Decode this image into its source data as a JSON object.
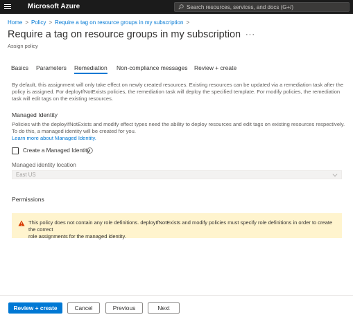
{
  "topbar": {
    "brand": "Microsoft Azure",
    "search_placeholder": "Search resources, services, and docs (G+/)"
  },
  "breadcrumb": {
    "items": [
      "Home",
      "Policy",
      "Require a tag on resource groups in my subscription"
    ]
  },
  "page": {
    "title": "Require a tag on resource groups in my subscription",
    "more": "···",
    "subtitle": "Assign policy"
  },
  "tabs": [
    "Basics",
    "Parameters",
    "Remediation",
    "Non-compliance messages",
    "Review + create"
  ],
  "active_tab": "Remediation",
  "intro": {
    "line1": "By default, this assignment will only take effect on newly created resources. Existing resources can be updated via a remediation task after the",
    "line2": "policy is assigned. For deployIfNotExists policies, the remediation task will deploy the specified template. For modify policies, the remediation",
    "line3": "task will edit tags on the existing resources."
  },
  "managed_identity": {
    "heading": "Managed Identity",
    "line1": "Policies with the deployIfNotExists and modify effect types need the ability to deploy resources and edit tags on existing resources respectively.",
    "line2": "To do this, a managed identity will be created for you.",
    "learn_more": "Learn more about Managed Identity.",
    "checkbox_label": "Create a Managed Identity",
    "checkbox_checked": false,
    "location_label": "Managed identity location",
    "location_value": "East US"
  },
  "permissions": {
    "heading": "Permissions",
    "warning_line1": "This policy does not contain any role definitions. deployIfNotExists and modify policies must specify role definitions in order to create the correct",
    "warning_line2": "role assignments for the managed identity."
  },
  "footer": {
    "review_create": "Review + create",
    "cancel": "Cancel",
    "previous": "Previous",
    "next": "Next"
  },
  "colors": {
    "accent": "#0078d4",
    "topbar": "#1b1b1b",
    "warning_bg": "#fff4ce",
    "warning_icon": "#d83b01"
  },
  "icons": {
    "menu": "hamburger-icon",
    "search": "search-icon",
    "info": "info-icon",
    "chevron": "chevron-down-icon",
    "warning": "warning-icon"
  }
}
